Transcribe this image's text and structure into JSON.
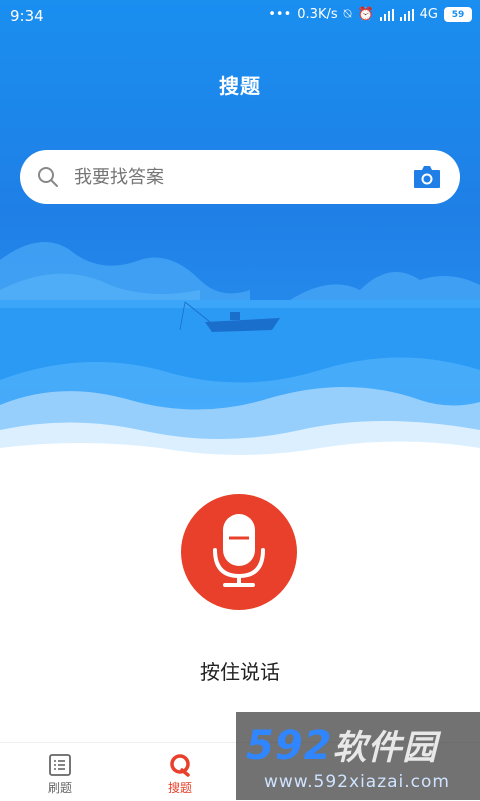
{
  "status_bar": {
    "time": "9:34",
    "dots": "•••",
    "speed": "0.3K/s",
    "network": "4G",
    "battery": "59"
  },
  "header": {
    "title": "搜题"
  },
  "search": {
    "placeholder": "我要找答案"
  },
  "voice": {
    "hold_label": "按住说话"
  },
  "tabs": [
    {
      "label": "刷题",
      "active": false
    },
    {
      "label": "搜题",
      "active": true
    }
  ],
  "watermark": {
    "brand": "592",
    "brand_suffix": "软件园",
    "url": "www.592xiazai.com"
  },
  "colors": {
    "primary_blue": "#1f7fe6",
    "mic_red": "#e8402a",
    "active_tab": "#e8402a",
    "inactive_tab": "#666666"
  }
}
